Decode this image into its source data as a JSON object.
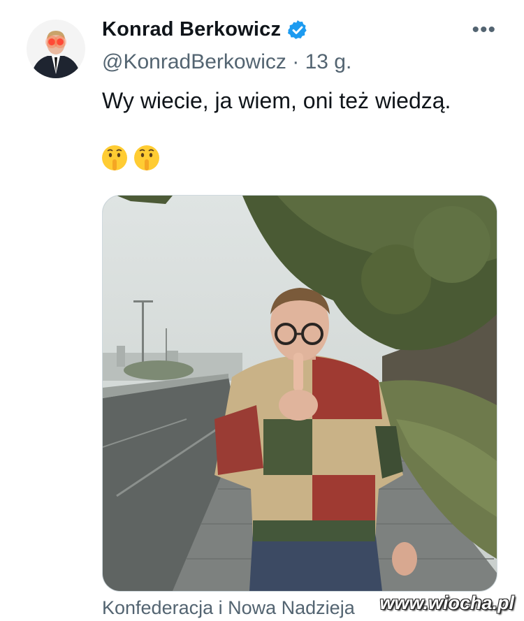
{
  "author": {
    "display_name": "Konrad Berkowicz",
    "handle": "@KonradBerkowicz",
    "separator": "·",
    "time_ago": "13 g.",
    "verified_icon": "verified-badge-icon",
    "avatar_icon": "avatar-image"
  },
  "tweet": {
    "text": "Wy wiecie, ja wiem, oni też wiedzą.",
    "emojis": [
      "🤫",
      "🤫"
    ]
  },
  "media": {
    "caption": "Konfederacja i Nowa Nadzieja"
  },
  "menu": {
    "more_icon": "more-options-icon",
    "more_label": "•••"
  },
  "watermark": {
    "text": "www.wiocha.pl"
  },
  "colors": {
    "verified_blue": "#1d9bf0",
    "text_primary": "#0f1419",
    "text_secondary": "#536471"
  }
}
